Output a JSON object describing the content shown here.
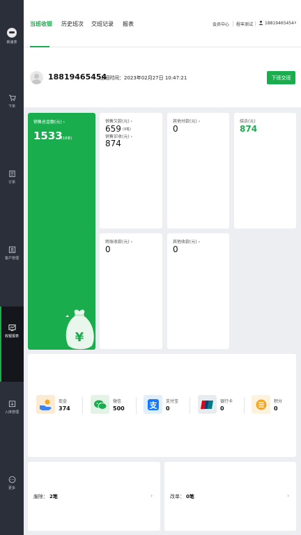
{
  "sidebar": {
    "logo_text": "新速茶",
    "items": [
      {
        "label": "下单",
        "icon": "cart-icon"
      },
      {
        "label": "订单",
        "icon": "order-icon"
      },
      {
        "label": "客户管理",
        "icon": "customer-icon"
      },
      {
        "label": "收银报表",
        "icon": "report-icon",
        "active": true
      },
      {
        "label": "入库管理",
        "icon": "warehouse-icon"
      },
      {
        "label": "更多",
        "icon": "more-icon"
      }
    ]
  },
  "header": {
    "tabs": [
      {
        "label": "当班收银",
        "active": true
      },
      {
        "label": "历史班次"
      },
      {
        "label": "交班记录"
      },
      {
        "label": "报表"
      }
    ],
    "member_center": "会员中心",
    "store": "程丰测试",
    "user": "18819465454"
  },
  "userbar": {
    "phone": "18819465454",
    "shift_label": "上班时间：",
    "shift_time": "2023年02月27日 10:47:21",
    "handover_button": "下班交班"
  },
  "summary": {
    "total_title": "销售总金额(元)",
    "total_value": "1533",
    "total_count": "(18单)",
    "sales_owed_label": "销售欠款(元)",
    "sales_owed_value": "659",
    "sales_owed_count": "(9笔)",
    "sales_received_label": "销售实收(元)",
    "sales_received_value": "874",
    "other_payment_label": "其他付款(元)",
    "other_payment_value": "0",
    "balance_label": "结余(元)",
    "balance_value": "874",
    "credit_collect_label": "赊账收款(元)",
    "credit_collect_value": "0",
    "other_income_label": "其他收款(元)",
    "other_income_value": "0"
  },
  "payments": [
    {
      "name": "现金",
      "value": "374",
      "icon": "cash-icon",
      "color": "#fcebd3"
    },
    {
      "name": "微信",
      "value": "500",
      "icon": "wechat-icon",
      "color": "#e3f4e7"
    },
    {
      "name": "支付宝",
      "value": "0",
      "icon": "alipay-icon",
      "color": "#e1effa"
    },
    {
      "name": "银行卡",
      "value": "0",
      "icon": "unionpay-icon",
      "color": "#e9ecef"
    },
    {
      "name": "积分",
      "value": "0",
      "icon": "points-icon",
      "color": "#fdf2dc"
    }
  ],
  "bottom": {
    "void_label": "废除：",
    "void_value": "2笔",
    "modify_label": "改单：",
    "modify_value": "0笔"
  },
  "colors": {
    "accent": "#1aad4d",
    "sidebar": "#2b2f3a"
  }
}
